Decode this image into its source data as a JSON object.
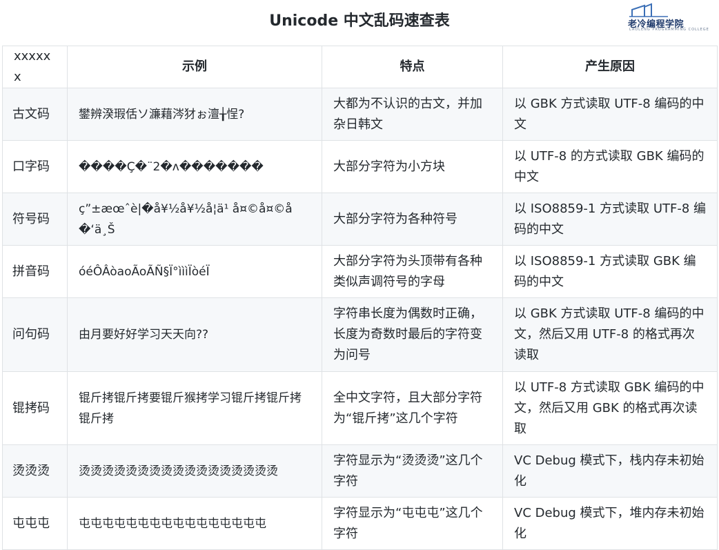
{
  "title": "Unicode 中文乱码速查表",
  "logo": {
    "text": "老冷编程学院",
    "subtext": "LAOLENG PROGRAMMING COLLEGE"
  },
  "table": {
    "headers": [
      "xxxxxx",
      "示例",
      "特点",
      "产生原因"
    ],
    "rows": [
      {
        "name": "古文码",
        "example": "鐢辨湀瑕佸ソ濂藉涔犲ぉ澶╁悜?",
        "feature": "大都为不认识的古文，并加杂日韩文",
        "cause": "以 GBK 方式读取 UTF-8 编码的中文"
      },
      {
        "name": "口字码",
        "example": "����Ç�¨2�ʌ�������",
        "feature": "大部分字符为小方块",
        "cause": "以 UTF-8 的方式读取 GBK 编码的中文"
      },
      {
        "name": "符号码",
        "example": "ç”±æœˆè|�å¥½å¥½å­¦ä¹ å¤©å¤©å�‘ä¸Š",
        "feature": "大部分字符为各种符号",
        "cause": "以 ISO8859-1 方式读取 UTF-8 编码的中文"
      },
      {
        "name": "拼音码",
        "example": "óéÔÂòaoÃoÃÑ§Ï°ìììÏòéÏ",
        "feature": "大部分字符为头顶带有各种类似声调符号的字母",
        "cause": "以 ISO8859-1 方式读取 GBK 编码的中文"
      },
      {
        "name": "问句码",
        "example": "由月要好好学习天天向??",
        "feature": "字符串长度为偶数时正确，长度为奇数时最后的字符变为问号",
        "cause": "以 GBK 方式读取 UTF-8 编码的中文，然后又用 UTF-8 的格式再次读取"
      },
      {
        "name": "锟拷码",
        "example": "锟斤拷锟斤拷要锟斤猴拷学习锟斤拷锟斤拷锟斤拷",
        "feature": "全中文字符，且大部分字符为“锟斤拷”这几个字符",
        "cause": "以 UTF-8 方式读取 GBK 编码的中文，然后又用 GBK 的格式再次读取"
      },
      {
        "name": "烫烫烫",
        "example": "烫烫烫烫烫烫烫烫烫烫烫烫烫烫烫烫烫",
        "feature": "字符显示为“烫烫烫”这几个字符",
        "cause": "VC Debug 模式下，栈内存未初始化"
      },
      {
        "name": "屯屯屯",
        "example": "屯屯屯屯屯屯屯屯屯屯屯屯屯屯屯屯",
        "feature": "字符显示为“屯屯屯”这几个字符",
        "cause": "VC Debug 模式下，堆内存未初始化"
      }
    ]
  }
}
